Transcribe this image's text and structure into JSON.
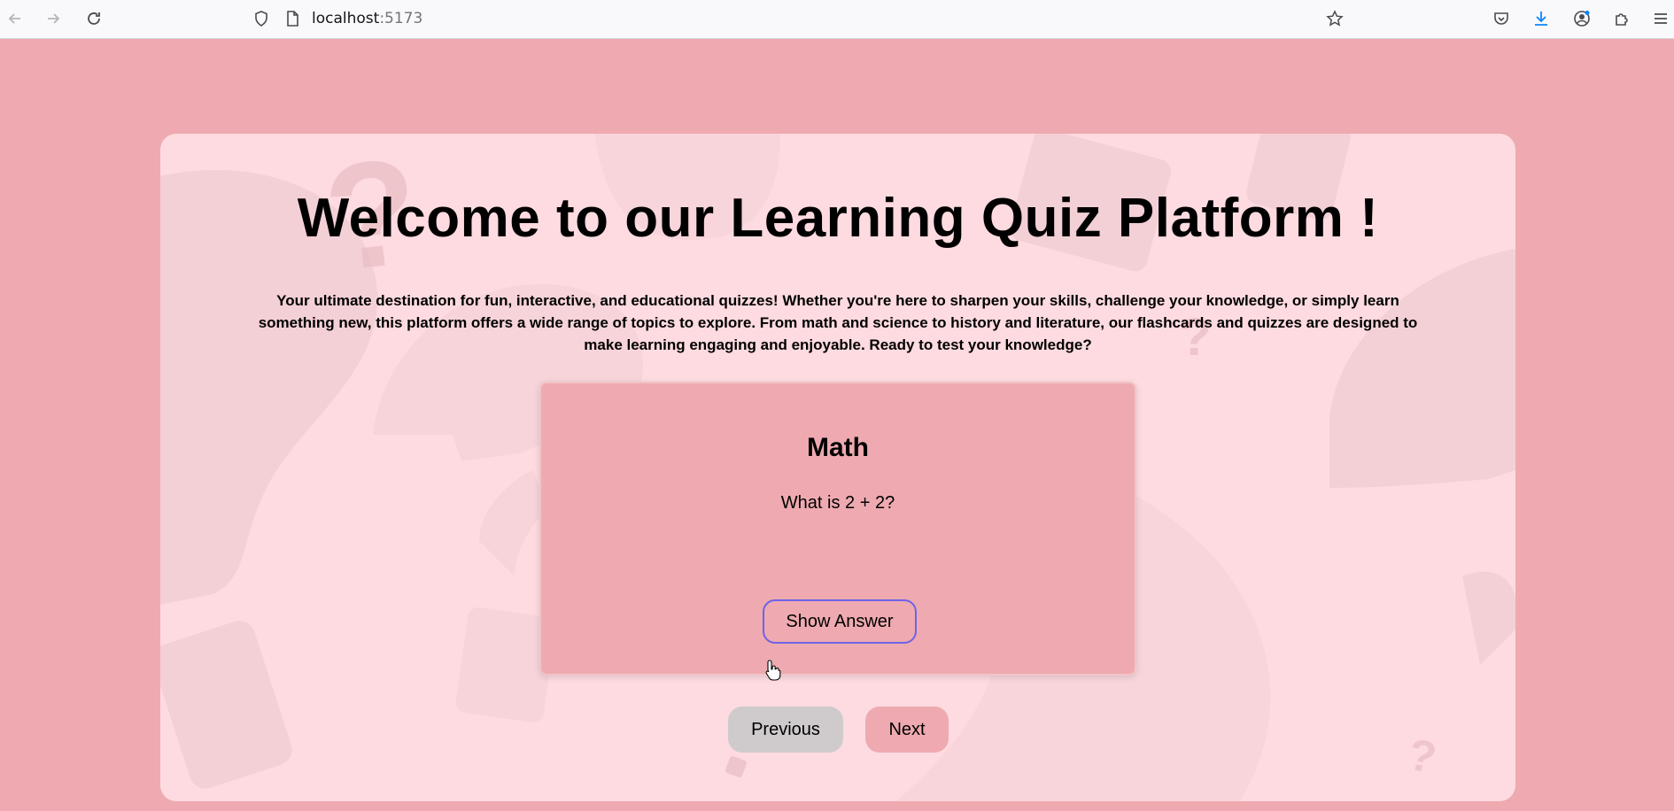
{
  "browser": {
    "url_host": "localhost",
    "url_port": ":5173",
    "icons": [
      "back-arrow-icon",
      "forward-arrow-icon",
      "reload-icon",
      "shield-icon",
      "page-icon",
      "star-icon",
      "pocket-icon",
      "download-icon",
      "account-icon",
      "extensions-icon",
      "menu-icon"
    ]
  },
  "page": {
    "title": "Welcome to our Learning Quiz Platform !",
    "intro": "Your ultimate destination for fun, interactive, and educational quizzes! Whether you're here to sharpen your skills, challenge your knowledge, or simply learn something new, this platform offers a wide range of topics to explore. From math and science to history and literature, our flashcards and quizzes are designed to make learning engaging and enjoyable. Ready to test your knowledge?"
  },
  "flashcard": {
    "subject": "Math",
    "question": "What is 2 + 2?",
    "show_answer_label": "Show Answer"
  },
  "nav": {
    "previous_label": "Previous",
    "next_label": "Next"
  },
  "colors": {
    "page_bg": "#eeaab0",
    "panel_bg": "#fddbe0",
    "card_bg": "#eeaab0",
    "focus_ring": "#6d63e8",
    "previous_button_bg": "#cfcbcc"
  }
}
